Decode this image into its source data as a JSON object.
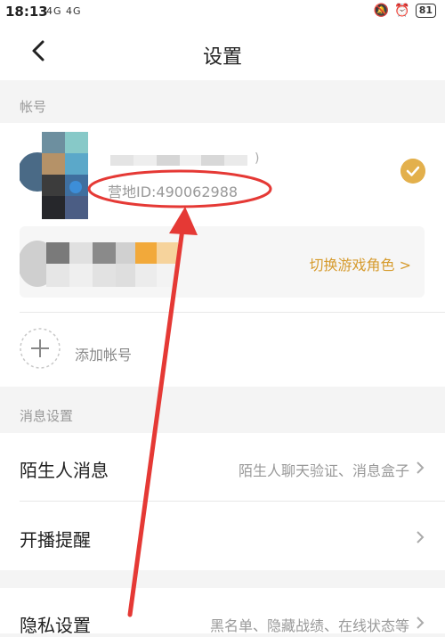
{
  "status_bar": {
    "time": "18:13",
    "left_icons": "4G 4G",
    "battery": "81"
  },
  "nav": {
    "title": "设置",
    "back_icon": "back-arrow-icon"
  },
  "account_section": {
    "label": "帐号",
    "camp_id": "营地ID:490062988",
    "name_suffix": ")",
    "switch_role": "切换游戏角色 >",
    "add_account": "添加帐号"
  },
  "message_section": {
    "label": "消息设置",
    "rows": [
      {
        "title": "陌生人消息",
        "subtitle": "陌生人聊天验证、消息盒子"
      },
      {
        "title": "开播提醒",
        "subtitle": ""
      }
    ]
  },
  "privacy_row": {
    "title": "隐私设置",
    "subtitle": "黑名单、隐藏战绩、在线状态等"
  },
  "colors": {
    "accent": "#e3b04c",
    "annotation_red": "#e53935"
  }
}
